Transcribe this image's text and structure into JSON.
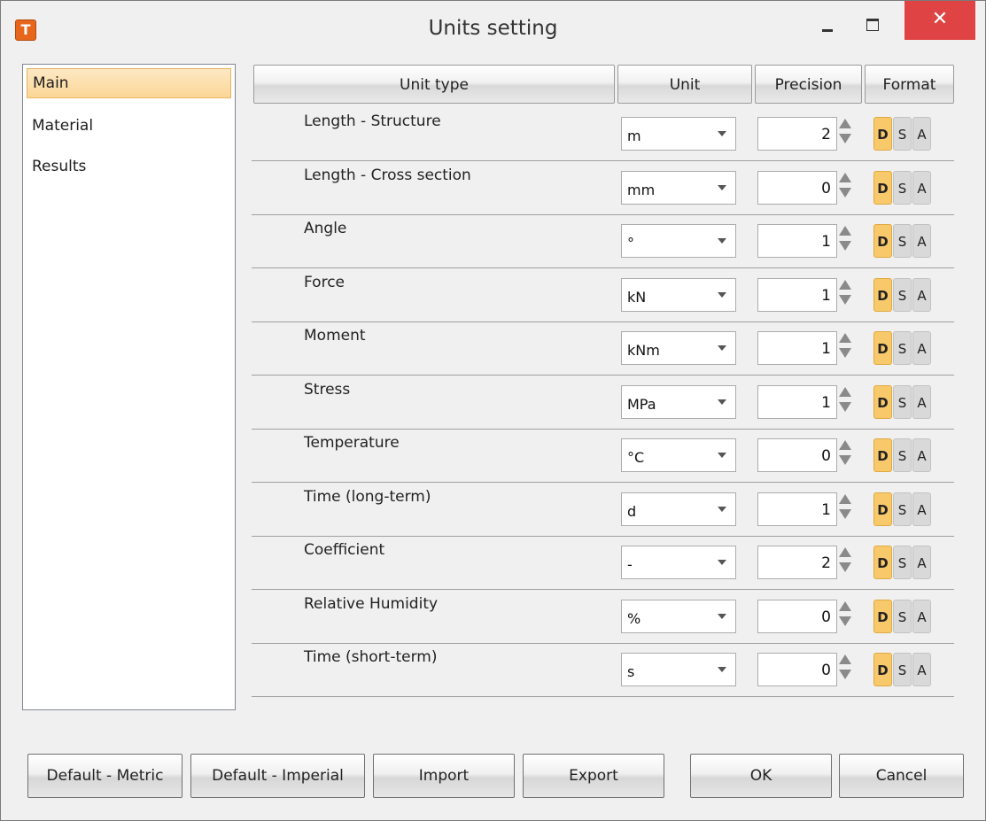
{
  "window": {
    "title": "Units setting",
    "close_glyph": "✕",
    "app_icon_glyph": "T"
  },
  "nav": [
    {
      "label": "Main",
      "selected": true
    },
    {
      "label": "Material",
      "selected": false
    },
    {
      "label": "Results",
      "selected": false
    }
  ],
  "columns": {
    "unit_type": "Unit type",
    "unit": "Unit",
    "precision": "Precision",
    "format": "Format"
  },
  "rows": [
    {
      "label": "Length - Structure",
      "unit": "m",
      "precision": "2"
    },
    {
      "label": "Length - Cross section",
      "unit": "mm",
      "precision": "0"
    },
    {
      "label": "Angle",
      "unit": "°",
      "precision": "1"
    },
    {
      "label": "Force",
      "unit": "kN",
      "precision": "1"
    },
    {
      "label": "Moment",
      "unit": "kNm",
      "precision": "1"
    },
    {
      "label": "Stress",
      "unit": "MPa",
      "precision": "1"
    },
    {
      "label": "Temperature",
      "unit": "°C",
      "precision": "0"
    },
    {
      "label": "Time (long-term)",
      "unit": "d",
      "precision": "1"
    },
    {
      "label": "Coefficient",
      "unit": "-",
      "precision": "2"
    },
    {
      "label": "Relative Humidity",
      "unit": "%",
      "precision": "0"
    },
    {
      "label": "Time (short-term)",
      "unit": "s",
      "precision": "0"
    }
  ],
  "format_options": {
    "d": "D",
    "s": "S",
    "a": "A",
    "selected": "D"
  },
  "buttons": {
    "default_metric": "Default - Metric",
    "default_imperial": "Default - Imperial",
    "import": "Import",
    "export": "Export",
    "ok": "OK",
    "cancel": "Cancel"
  },
  "colors": {
    "selected_nav": "#fbd796",
    "format_selected": "#f8c96b",
    "close": "#e04343",
    "app_icon": "#e8661c"
  }
}
